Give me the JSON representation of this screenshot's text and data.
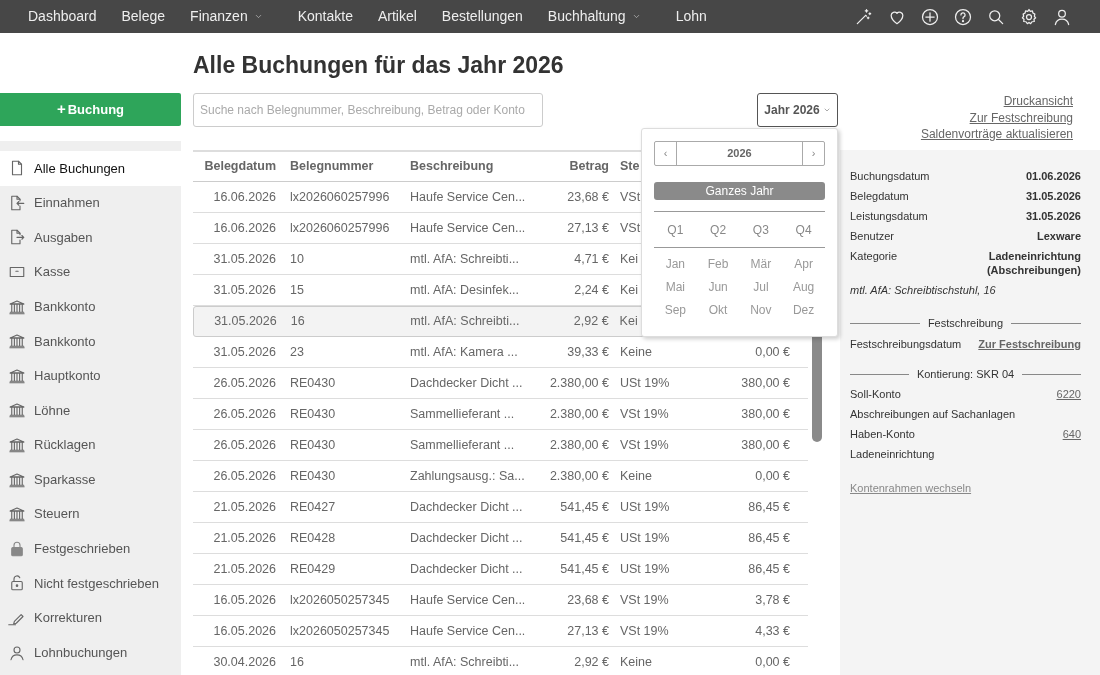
{
  "nav": {
    "items": [
      {
        "label": "Dashboard",
        "dropdown": false
      },
      {
        "label": "Belege",
        "dropdown": false
      },
      {
        "label": "Finanzen",
        "dropdown": true
      },
      {
        "label": "Kontakte",
        "dropdown": false
      },
      {
        "label": "Artikel",
        "dropdown": false
      },
      {
        "label": "Bestellungen",
        "dropdown": false
      },
      {
        "label": "Buchhaltung",
        "dropdown": true
      },
      {
        "label": "Lohn",
        "dropdown": false
      }
    ]
  },
  "sidebar": {
    "new_button": {
      "icon": "+",
      "label": "Buchung"
    },
    "items": [
      {
        "label": "Alle Buchungen",
        "kind": "document",
        "selected": true
      },
      {
        "label": "Einnahmen",
        "kind": "income",
        "selected": false
      },
      {
        "label": "Ausgaben",
        "kind": "expense",
        "selected": false
      },
      {
        "label": "Kasse",
        "kind": "cash",
        "selected": false
      },
      {
        "label": "Bankkonto",
        "kind": "bank",
        "selected": false
      },
      {
        "label": "Bankkonto",
        "kind": "bank",
        "selected": false
      },
      {
        "label": "Hauptkonto",
        "kind": "bank",
        "selected": false
      },
      {
        "label": "Löhne",
        "kind": "bank",
        "selected": false
      },
      {
        "label": "Rücklagen",
        "kind": "bank",
        "selected": false
      },
      {
        "label": "Sparkasse",
        "kind": "bank",
        "selected": false
      },
      {
        "label": "Steuern",
        "kind": "bank",
        "selected": false
      },
      {
        "label": "Festgeschrieben",
        "kind": "locked",
        "selected": false
      },
      {
        "label": "Nicht festgeschrieben",
        "kind": "unlocked",
        "selected": false
      },
      {
        "label": "Korrekturen",
        "kind": "correction",
        "selected": false
      },
      {
        "label": "Lohnbuchungen",
        "kind": "payroll",
        "selected": false
      }
    ]
  },
  "title": "Alle Buchungen für das Jahr 2026",
  "search": {
    "placeholder": "Suche nach Belegnummer, Beschreibung, Betrag oder Konto"
  },
  "year_button": {
    "label": "Jahr 2026"
  },
  "links": [
    "Druckansicht",
    "Zur Festschreibung",
    "Saldenvorträge aktualisieren"
  ],
  "table": {
    "columns": [
      "Belegdatum",
      "Belegnummer",
      "Beschreibung",
      "Betrag",
      "Ste"
    ],
    "rows": [
      {
        "date": "16.06.2026",
        "number": "lx2026060257996",
        "description": "Haufe Service Cen...",
        "amount": "23,68 €",
        "tax": "VSt",
        "selected": false
      },
      {
        "date": "16.06.2026",
        "number": "lx2026060257996",
        "description": "Haufe Service Cen...",
        "amount": "27,13 €",
        "tax": "VSt",
        "selected": false
      },
      {
        "date": "31.05.2026",
        "number": "10",
        "description": "mtl. AfA: Schreibti...",
        "amount": "4,71 €",
        "tax": "Kei",
        "selected": false
      },
      {
        "date": "31.05.2026",
        "number": "15",
        "description": "mtl. AfA: Desinfek...",
        "amount": "2,24 €",
        "tax": "Kei",
        "selected": false
      },
      {
        "date": "31.05.2026",
        "number": "16",
        "description": "mtl. AfA: Schreibti...",
        "amount": "2,92 €",
        "tax": "Kei",
        "selected": true
      },
      {
        "date": "31.05.2026",
        "number": "23",
        "description": "mtl. AfA: Kamera ...",
        "amount": "39,33 €",
        "tax": "Keine",
        "tax_amount": "0,00 €",
        "selected": false
      },
      {
        "date": "26.05.2026",
        "number": "RE0430",
        "description": "Dachdecker Dicht ...",
        "amount": "2.380,00 €",
        "tax": "USt 19%",
        "tax_amount": "380,00 €",
        "selected": false
      },
      {
        "date": "26.05.2026",
        "number": "RE0430",
        "description": "Sammellieferant ...",
        "amount": "2.380,00 €",
        "tax": "VSt 19%",
        "tax_amount": "380,00 €",
        "selected": false
      },
      {
        "date": "26.05.2026",
        "number": "RE0430",
        "description": "Sammellieferant ...",
        "amount": "2.380,00 €",
        "tax": "VSt 19%",
        "tax_amount": "380,00 €",
        "selected": false
      },
      {
        "date": "26.05.2026",
        "number": "RE0430",
        "description": "Zahlungsausg.: Sa...",
        "amount": "2.380,00 €",
        "tax": "Keine",
        "tax_amount": "0,00 €",
        "selected": false
      },
      {
        "date": "21.05.2026",
        "number": "RE0427",
        "description": "Dachdecker Dicht ...",
        "amount": "541,45 €",
        "tax": "USt 19%",
        "tax_amount": "86,45 €",
        "selected": false
      },
      {
        "date": "21.05.2026",
        "number": "RE0428",
        "description": "Dachdecker Dicht ...",
        "amount": "541,45 €",
        "tax": "USt 19%",
        "tax_amount": "86,45 €",
        "selected": false
      },
      {
        "date": "21.05.2026",
        "number": "RE0429",
        "description": "Dachdecker Dicht ...",
        "amount": "541,45 €",
        "tax": "USt 19%",
        "tax_amount": "86,45 €",
        "selected": false
      },
      {
        "date": "16.05.2026",
        "number": "lx2026050257345",
        "description": "Haufe Service Cen...",
        "amount": "23,68 €",
        "tax": "VSt 19%",
        "tax_amount": "3,78 €",
        "selected": false
      },
      {
        "date": "16.05.2026",
        "number": "lx2026050257345",
        "description": "Haufe Service Cen...",
        "amount": "27,13 €",
        "tax": "VSt 19%",
        "tax_amount": "4,33 €",
        "selected": false
      },
      {
        "date": "30.04.2026",
        "number": "16",
        "description": "mtl. AfA: Schreibti...",
        "amount": "2,92 €",
        "tax": "Keine",
        "tax_amount": "0,00 €",
        "selected": false
      }
    ]
  },
  "year_picker": {
    "prev": "‹",
    "year": "2026",
    "next": "›",
    "whole_year": {
      "label": "Ganzes Jahr",
      "selected": true
    },
    "quarters": [
      {
        "label": "Q1",
        "selected": false
      },
      {
        "label": "Q2",
        "selected": false
      },
      {
        "label": "Q3",
        "selected": false
      },
      {
        "label": "Q4",
        "selected": false
      }
    ],
    "months": [
      {
        "label": "Jan",
        "selected": false
      },
      {
        "label": "Feb",
        "selected": false
      },
      {
        "label": "Mär",
        "selected": false
      },
      {
        "label": "Apr",
        "selected": false
      },
      {
        "label": "Mai",
        "selected": false
      },
      {
        "label": "Jun",
        "selected": false
      },
      {
        "label": "Jul",
        "selected": false
      },
      {
        "label": "Aug",
        "selected": false
      },
      {
        "label": "Sep",
        "selected": false
      },
      {
        "label": "Okt",
        "selected": false
      },
      {
        "label": "Nov",
        "selected": false
      },
      {
        "label": "Dez",
        "selected": false
      }
    ]
  },
  "details": {
    "fields": [
      {
        "label": "Buchungsdatum",
        "value": "01.06.2026"
      },
      {
        "label": "Belegdatum",
        "value": "31.05.2026"
      },
      {
        "label": "Leistungsdatum",
        "value": "31.05.2026"
      },
      {
        "label": "Benutzer",
        "value": "Lexware"
      },
      {
        "label": "Kategorie",
        "value": "Ladeneinrichtung (Abschreibungen)"
      }
    ],
    "note": "mtl. AfA: Schreibtischstuhl, 16",
    "lock_heading": "Festschreibung",
    "lock_field": {
      "label": "Festschreibungsdatum",
      "link": "Zur Festschreibung"
    },
    "account_heading": "Kontierung: SKR 04",
    "accounts": [
      {
        "label": "Soll-Konto",
        "number": "6220",
        "name": "Abschreibungen auf Sachanlagen"
      },
      {
        "label": "Haben-Konto",
        "number": "640",
        "name": "Ladeneinrichtung"
      }
    ],
    "change_link": "Kontenrahmen wechseln"
  }
}
